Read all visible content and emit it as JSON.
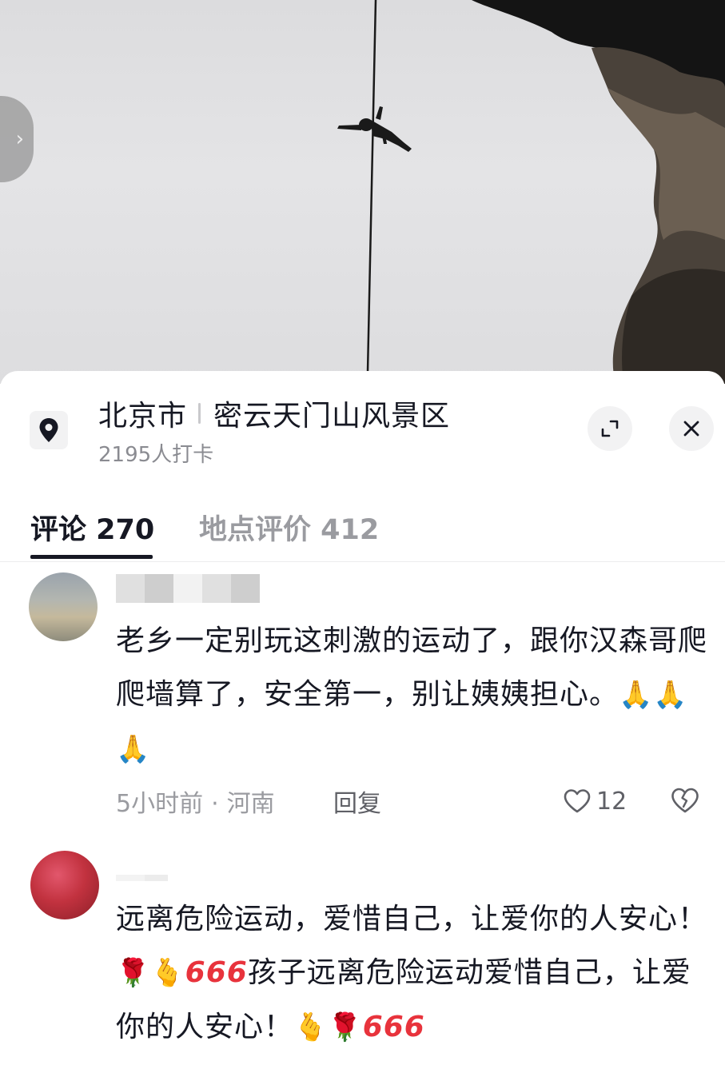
{
  "photo": {
    "prev_glyph": "›",
    "description_icon": "climber-photo"
  },
  "location": {
    "city": "北京市",
    "place": "密云天门山风景区",
    "checkins": "2195人打卡"
  },
  "tabs": [
    {
      "label": "评论 270",
      "active": true
    },
    {
      "label": "地点评价 412",
      "active": false
    }
  ],
  "comments": [
    {
      "text": "老乡一定别玩这刺激的运动了，跟你汉森哥爬爬墙算了，安全第一，别让姨姨担心。",
      "emojis": "🙏🙏🙏",
      "time": "5小时前",
      "dot": "·",
      "region": "河南",
      "reply": "回复",
      "likes": "12"
    },
    {
      "text_a": "远离危险运动，爱惜自己，让爱你的人安心！",
      "emojis_a": "🌹🫰",
      "text_666a": "666",
      "text_b": "孩子远离危险运动爱惜自己，让爱你的人安心！",
      "emojis_b": "🫰🌹",
      "text_666b": "666"
    }
  ],
  "colors": {
    "primary_text": "#161823",
    "secondary_text": "#8a8b91",
    "inactive_tab": "#9a9ba0",
    "accent_666": "#e8333c"
  }
}
